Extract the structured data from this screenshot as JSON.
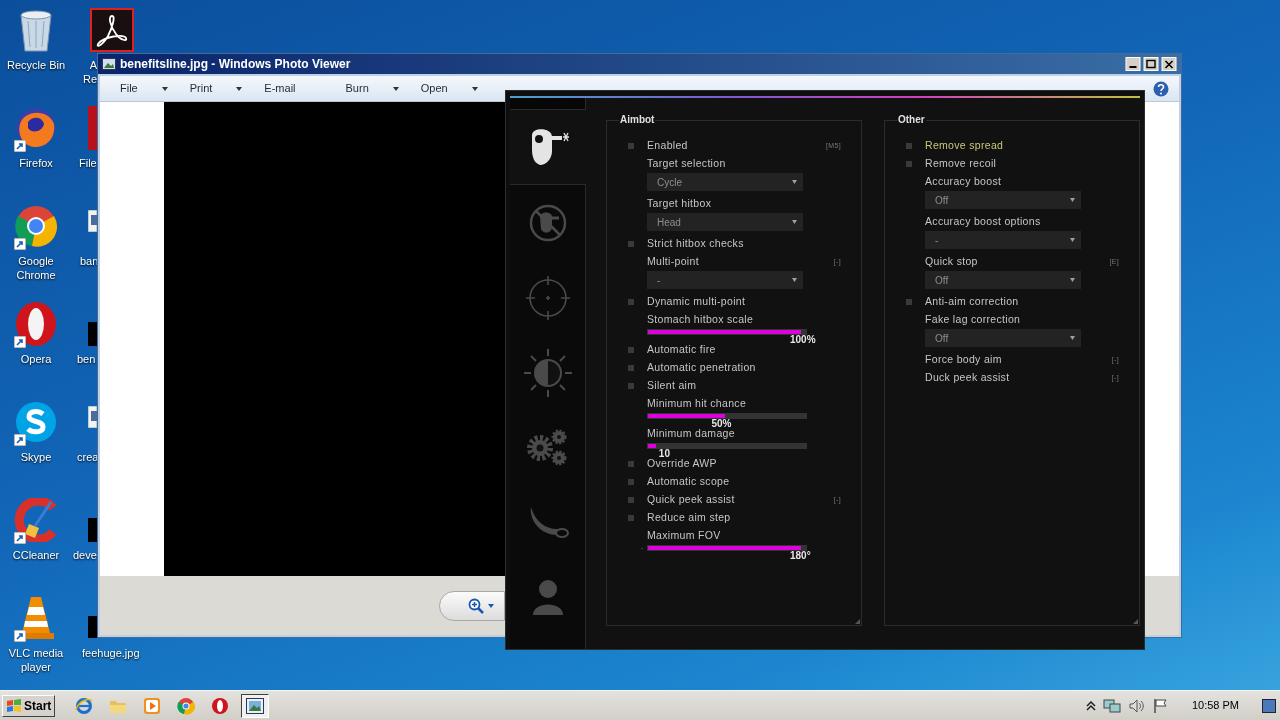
{
  "desktop": {
    "icons": [
      {
        "lines": [
          "Recycle Bin"
        ]
      },
      {
        "lines": [
          "Firefox"
        ]
      },
      {
        "lines": [
          "Google",
          "Chrome"
        ]
      },
      {
        "lines": [
          "Opera"
        ]
      },
      {
        "lines": [
          "Skype"
        ]
      },
      {
        "lines": [
          "CCleaner"
        ]
      },
      {
        "lines": [
          "VLC media",
          "player"
        ]
      }
    ],
    "icons_column_2": [
      {
        "lines": [
          "A",
          "Re"
        ]
      },
      {
        "lines": [
          "File"
        ]
      },
      {
        "lines": [
          "ban"
        ]
      },
      {
        "lines": [
          "ben"
        ]
      },
      {
        "lines": [
          "crea"
        ]
      },
      {
        "lines": [
          "deve"
        ]
      },
      {
        "lines": [
          "feehuge.jpg"
        ]
      }
    ]
  },
  "photo_viewer": {
    "title": "benefitsline.jpg - Windows Photo Viewer",
    "menu": [
      {
        "label": "File",
        "dropdown": true
      },
      {
        "label": "Print",
        "dropdown": true
      },
      {
        "label": "E-mail",
        "dropdown": false
      },
      {
        "label": "Burn",
        "dropdown": true
      },
      {
        "label": "Open",
        "dropdown": true
      }
    ]
  },
  "cheat_menu": {
    "tabs": [
      {
        "selected": true
      },
      {
        "selected": false
      },
      {
        "selected": false
      },
      {
        "selected": false
      },
      {
        "selected": false
      },
      {
        "selected": false
      },
      {
        "selected": false
      }
    ],
    "groups": [
      {
        "title": "Aimbot",
        "rows": [
          {
            "kind": "checkbox",
            "label": "Enabled",
            "checked": false,
            "highlighted": false,
            "key": "[M5]"
          },
          {
            "kind": "dropdown",
            "label": "Target selection",
            "value": "Cycle",
            "highlighted": false
          },
          {
            "kind": "dropdown",
            "label": "Target hitbox",
            "value": "Head",
            "highlighted": false
          },
          {
            "kind": "checkbox",
            "label": "Strict hitbox checks",
            "checked": false,
            "highlighted": false
          },
          {
            "kind": "dropdown",
            "label": "Multi-point",
            "value": "-",
            "highlighted": false,
            "key": "[-]"
          },
          {
            "kind": "checkbox",
            "label": "Dynamic multi-point",
            "checked": false,
            "highlighted": false
          },
          {
            "kind": "slider",
            "label": "Stomach hitbox scale",
            "level": 1,
            "reading": "100%",
            "highlighted": false
          },
          {
            "kind": "checkbox",
            "label": "Automatic fire",
            "checked": false,
            "highlighted": false
          },
          {
            "kind": "checkbox",
            "label": "Automatic penetration",
            "checked": false,
            "highlighted": false
          },
          {
            "kind": "checkbox",
            "label": "Silent aim",
            "checked": false,
            "highlighted": false
          },
          {
            "kind": "slider",
            "label": "Minimum hit chance",
            "level": 0.5,
            "reading": "50%",
            "highlighted": false
          },
          {
            "kind": "slider",
            "label": "Minimum damage",
            "level": 0.05,
            "reading": "10",
            "highlighted": false
          },
          {
            "kind": "checkbox",
            "label": "Override AWP",
            "checked": false,
            "highlighted": false
          },
          {
            "kind": "checkbox",
            "label": "Automatic scope",
            "checked": false,
            "highlighted": false
          },
          {
            "kind": "checkbox",
            "label": "Quick peek assist",
            "checked": false,
            "highlighted": false,
            "key": "[-]"
          },
          {
            "kind": "checkbox",
            "label": "Reduce aim step",
            "checked": false,
            "highlighted": false
          },
          {
            "kind": "slider",
            "label": "Maximum FOV",
            "level": 1,
            "reading": "180°",
            "decrement": "-",
            "highlighted": false
          }
        ]
      },
      {
        "title": "Other",
        "rows": [
          {
            "kind": "checkbox",
            "label": "Remove spread",
            "checked": false,
            "highlighted": true
          },
          {
            "kind": "checkbox",
            "label": "Remove recoil",
            "checked": false,
            "highlighted": false
          },
          {
            "kind": "dropdown",
            "label": "Accuracy boost",
            "value": "Off",
            "highlighted": false
          },
          {
            "kind": "dropdown",
            "label": "Accuracy boost options",
            "value": "-",
            "highlighted": false
          },
          {
            "kind": "dropdown",
            "label": "Quick stop",
            "value": "Off",
            "highlighted": false,
            "key": "[E]"
          },
          {
            "kind": "checkbox",
            "label": "Anti-aim correction",
            "checked": false,
            "highlighted": false
          },
          {
            "kind": "dropdown",
            "label": "Fake lag correction",
            "value": "Off",
            "highlighted": false
          },
          {
            "kind": "label",
            "label": "Force body aim",
            "highlighted": false,
            "key": "[-]"
          },
          {
            "kind": "label",
            "label": "Duck peek assist",
            "highlighted": false,
            "key": "[-]"
          }
        ]
      }
    ]
  },
  "taskbar": {
    "start": "Start",
    "pinned": [
      {
        "selected": false
      },
      {
        "selected": false
      },
      {
        "selected": false
      },
      {
        "selected": false
      },
      {
        "selected": false
      },
      {
        "selected": true
      }
    ],
    "clock": "10:58 PM"
  }
}
